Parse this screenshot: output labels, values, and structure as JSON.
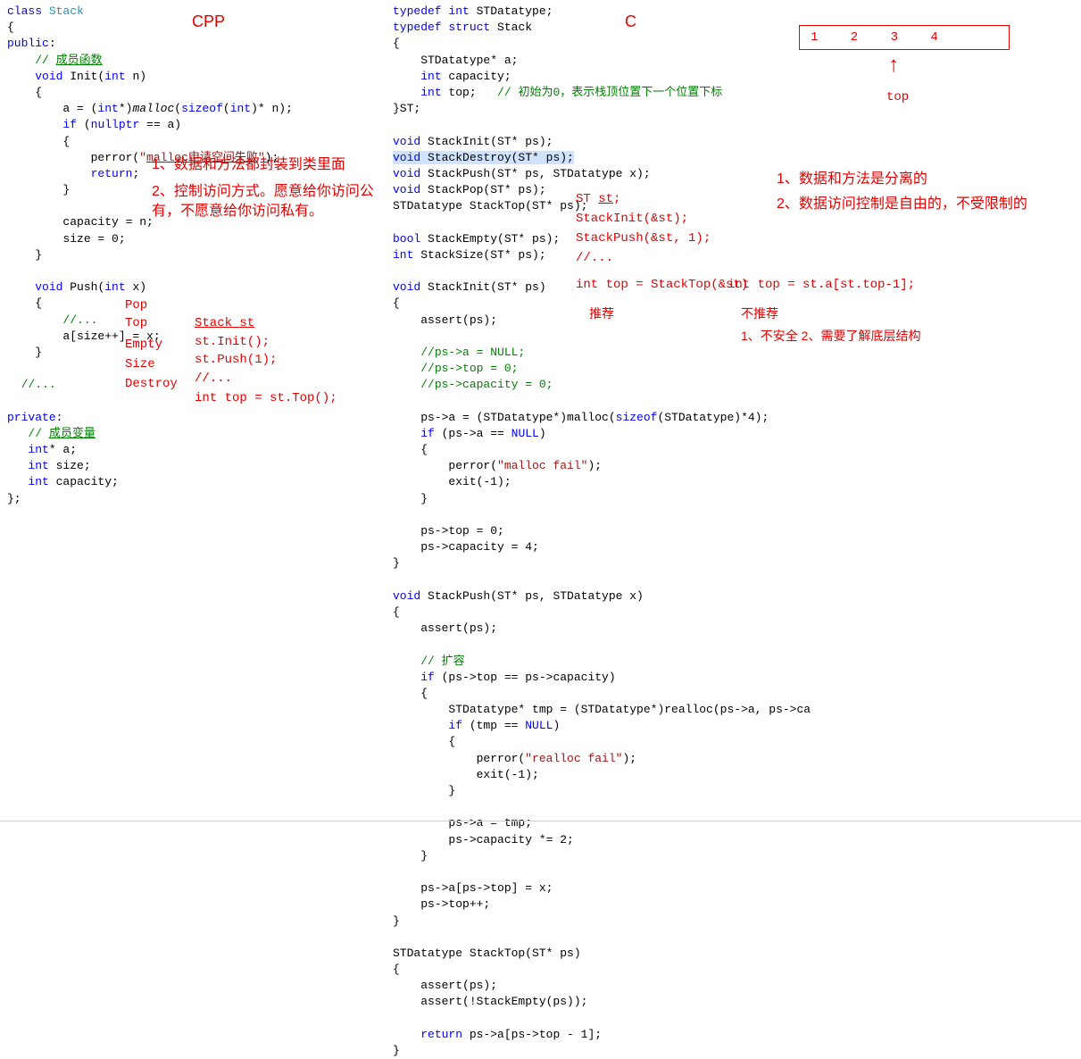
{
  "labels": {
    "cpp": "CPP",
    "c": "C",
    "top": "top"
  },
  "stack": {
    "values": "1  2  3  4"
  },
  "cpp_code": {
    "l1": "class Stack",
    "l2": "{",
    "l3": "public:",
    "l4": "    // 成员函数",
    "l5": "    void Init(int n)",
    "l6": "    {",
    "l7": "        a = (int*)malloc(sizeof(int)* n);",
    "l8": "        if (nullptr == a)",
    "l9": "        {",
    "l10": "            perror(\"malloc申请空间失败\");",
    "l11": "            return;",
    "l12": "        }",
    "l13": "        capacity = n;",
    "l14": "        size = 0;",
    "l15": "    }",
    "l16": "",
    "l17": "    void Push(int x)",
    "l18": "    {",
    "l19": "        //...",
    "l20": "        a[size++] = x;",
    "l21": "    }",
    "l22": "",
    "l23": "  //...",
    "l24": "",
    "l25": "private:",
    "l26": "   // 成员变量",
    "l27": "   int* a;",
    "l28": "   int size;",
    "l29": "   int capacity;",
    "l30": "};"
  },
  "cpp_notes": {
    "n1": "1、数据和方法都封装到类里面",
    "n2": "2、控制访问方式。愿意给你访问公有，不愿意给你访问私有。"
  },
  "cpp_list": {
    "l1": "Pop",
    "l2": "Top",
    "l3": "Empty",
    "l4": "Size",
    "l5": "Destroy",
    "r1": "Stack st",
    "r2": "st.Init();",
    "r3": "st.Push(1);",
    "r4": "//...",
    "r5": "int top = st.Top();"
  },
  "c_code": {
    "l1": "typedef int STDatatype;",
    "l2": "typedef struct Stack",
    "l3": "{",
    "l4": "    STDatatype* a;",
    "l5": "    int capacity;",
    "l6": "    int top;   // 初始为0，表示栈顶位置下一个位置下标",
    "l7": "}ST;",
    "l8": "",
    "l9": "void StackInit(ST* ps);",
    "l10": "void StackDestroy(ST* ps);",
    "l11": "void StackPush(ST* ps, STDatatype x);",
    "l12": "void StackPop(ST* ps);",
    "l13": "STDatatype StackTop(ST* ps);",
    "l14": "",
    "l15": "bool StackEmpty(ST* ps);",
    "l16": "int StackSize(ST* ps);",
    "l17": "",
    "l18": "void StackInit(ST* ps)",
    "l19": "{",
    "l20": "    assert(ps);",
    "l21": "",
    "l22": "    //ps->a = NULL;",
    "l23": "    //ps->top = 0;",
    "l24": "    //ps->capacity = 0;",
    "l25": "",
    "l26": "    ps->a = (STDatatype*)malloc(sizeof(STDatatype)*4);",
    "l27": "    if (ps->a == NULL)",
    "l28": "    {",
    "l29": "        perror(\"malloc fail\");",
    "l30": "        exit(-1);",
    "l31": "    }",
    "l32": "",
    "l33": "    ps->top = 0;",
    "l34": "    ps->capacity = 4;",
    "l35": "}",
    "l36": "",
    "l37": "void StackPush(ST* ps, STDatatype x)",
    "l38": "{",
    "l39": "    assert(ps);",
    "l40": "",
    "l41": "    // 扩容",
    "l42": "    if (ps->top == ps->capacity)",
    "l43": "    {",
    "l44": "        STDatatype* tmp = (STDatatype*)realloc(ps->a, ps->ca",
    "l45": "        if (tmp == NULL)",
    "l46": "        {",
    "l47": "            perror(\"realloc fail\");",
    "l48": "            exit(-1);",
    "l49": "        }",
    "l50": "",
    "l51": "        ps->a = tmp;",
    "l52": "        ps->capacity *= 2;",
    "l53": "    }",
    "l54": "",
    "l55": "    ps->a[ps->top] = x;",
    "l56": "    ps->top++;",
    "l57": "}",
    "l58": "",
    "l59": "STDatatype StackTop(ST* ps)",
    "l60": "{",
    "l61": "    assert(ps);",
    "l62": "    assert(!StackEmpty(ps));",
    "l63": "",
    "l64": "    return ps->a[ps->top - 1];",
    "l65": "}"
  },
  "c_notes": {
    "st": "ST st;",
    "init": "StackInit(&st);",
    "push": "StackPush(&st, 1);",
    "dots": "//...",
    "topa": "int top = StackTop(&st)",
    "topb": "int top = st.a[st.top-1];",
    "rec": "推荐",
    "notrec": "不推荐",
    "unsafe": "1、不安全   2、需要了解底层结构"
  },
  "right_notes": {
    "n1": "1、数据和方法是分离的",
    "n2": "2、数据访问控制是自由的，不受限制的"
  }
}
